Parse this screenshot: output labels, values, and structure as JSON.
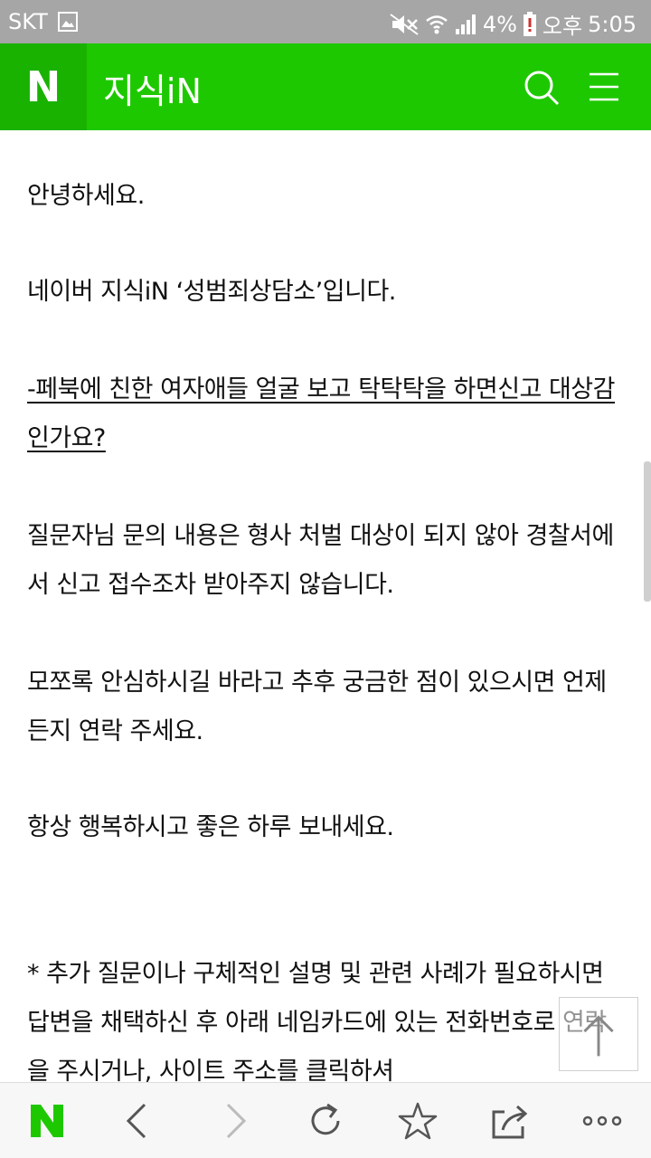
{
  "status_bar": {
    "carrier": "SKT",
    "battery_percent": "4%",
    "ampm": "오후",
    "time": "5:05"
  },
  "header": {
    "logo_letter": "N",
    "title": "지식iN",
    "accent_color": "#1ec800"
  },
  "content": {
    "paragraphs": [
      "안녕하세요.",
      "네이버 지식iN ‘성범죄상담소’입니다.",
      "-페북에 친한 여자애들 얼굴 보고 탁탁탁을 하면신고 대상감인가요?",
      "질문자님 문의 내용은 형사 처벌 대상이 되지 않아 경찰서에서 신고 접수조차 받아주지 않습니다.",
      "모쪼록 안심하시길 바라고 추후 궁금한 점이 있으시면 언제든지 연락 주세요.",
      "항상 행복하시고 좋은 하루 보내세요.",
      "* 추가 질문이나 구체적인 설명 및 관련 사례가 필요하시면 답변을 채택하신 후 아래 네임카드에 있는 전화번호로 연락을 주시거나, 사이트 주소를 클릭하셔"
    ]
  },
  "toolbar": {
    "logo_letter": "N",
    "icons": [
      "naver-home-icon",
      "back-arrow-icon",
      "forward-arrow-icon",
      "refresh-icon",
      "star-icon",
      "share-icon",
      "more-icon"
    ]
  }
}
